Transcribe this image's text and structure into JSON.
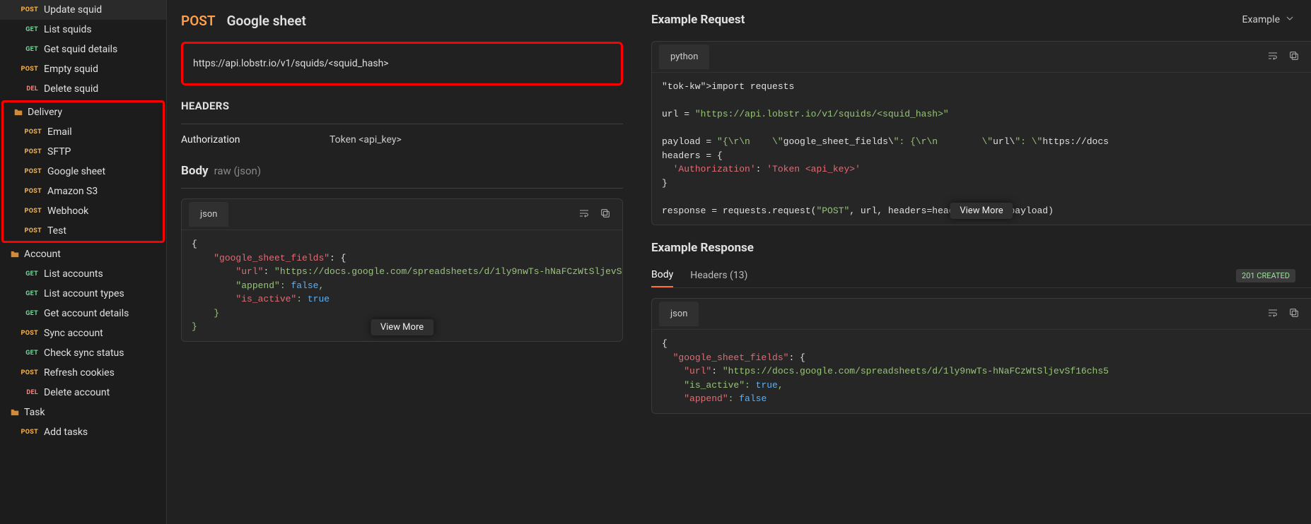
{
  "sidebar": {
    "group1": [
      {
        "method": "POST",
        "mclass": "m-post",
        "label": "Update squid"
      },
      {
        "method": "GET",
        "mclass": "m-get",
        "label": "List squids"
      },
      {
        "method": "GET",
        "mclass": "m-get",
        "label": "Get squid details"
      },
      {
        "method": "POST",
        "mclass": "m-post",
        "label": "Empty squid"
      },
      {
        "method": "DEL",
        "mclass": "m-del",
        "label": "Delete squid"
      }
    ],
    "delivery_folder": "Delivery",
    "delivery_items": [
      {
        "method": "POST",
        "mclass": "m-post",
        "label": "Email"
      },
      {
        "method": "POST",
        "mclass": "m-post",
        "label": "SFTP"
      },
      {
        "method": "POST",
        "mclass": "m-post",
        "label": "Google sheet"
      },
      {
        "method": "POST",
        "mclass": "m-post",
        "label": "Amazon S3"
      },
      {
        "method": "POST",
        "mclass": "m-post",
        "label": "Webhook"
      },
      {
        "method": "POST",
        "mclass": "m-post",
        "label": "Test"
      }
    ],
    "account_folder": "Account",
    "account_items": [
      {
        "method": "GET",
        "mclass": "m-get",
        "label": "List accounts"
      },
      {
        "method": "GET",
        "mclass": "m-get",
        "label": "List account types"
      },
      {
        "method": "GET",
        "mclass": "m-get",
        "label": "Get account details"
      },
      {
        "method": "POST",
        "mclass": "m-post",
        "label": "Sync account"
      },
      {
        "method": "GET",
        "mclass": "m-get",
        "label": "Check sync status"
      },
      {
        "method": "POST",
        "mclass": "m-post",
        "label": "Refresh cookies"
      },
      {
        "method": "DEL",
        "mclass": "m-del",
        "label": "Delete account"
      }
    ],
    "task_folder": "Task",
    "task_items": [
      {
        "method": "POST",
        "mclass": "m-post",
        "label": "Add tasks"
      }
    ]
  },
  "request": {
    "method": "POST",
    "name": "Google sheet",
    "url": "https://api.lobstr.io/v1/squids/<squid_hash>",
    "headers_title": "HEADERS",
    "auth_key": "Authorization",
    "auth_val": "Token <api_key>",
    "body_label": "Body",
    "body_hint": "raw (json)",
    "body_tab": "json",
    "body_code": "{\n    \"google_sheet_fields\": {\n        \"url\": \"https://docs.google.com/spreadsheets/d/1ly9nwTs-hNaFCzWtSljevSf\n        \"append\": false,\n        \"is_active\": true\n    }\n}",
    "view_more": "View More"
  },
  "example": {
    "req_title": "Example Request",
    "dropdown": "Example",
    "lang_tab": "python",
    "req_code": "import requests\n\nurl = \"https://api.lobstr.io/v1/squids/<squid_hash>\"\n\npayload = \"{\\r\\n    \\\"google_sheet_fields\\\": {\\r\\n        \\\"url\\\": \\\"https://docs\nheaders = {\n  'Authorization': 'Token <api_key>'\n}\n\nresponse = requests.request(\"POST\", url, headers=headers, data=payload)",
    "req_view_more": "View More",
    "resp_title": "Example Response",
    "tab_body": "Body",
    "tab_headers": "Headers (13)",
    "status": "201 CREATED",
    "resp_tab": "json",
    "resp_code": "{\n  \"google_sheet_fields\": {\n    \"url\": \"https://docs.google.com/spreadsheets/d/1ly9nwTs-hNaFCzWtSljevSf16chs5\n    \"is_active\": true,\n    \"append\": false"
  }
}
